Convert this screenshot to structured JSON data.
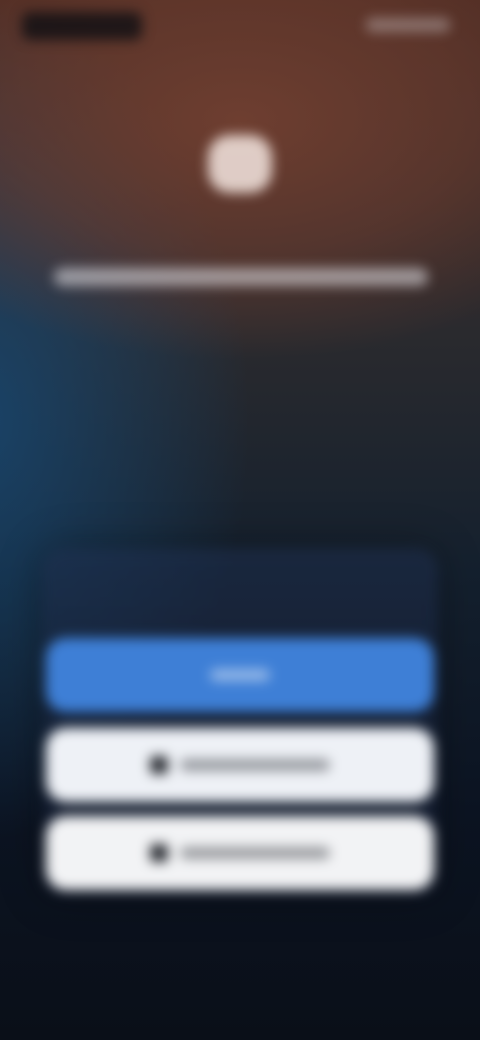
{
  "status_bar": {
    "left_text": "",
    "right_text": ""
  },
  "header": {
    "logo_icon": "app-logo",
    "tagline": ""
  },
  "middle": {
    "subtle_text": ""
  },
  "login_card": {
    "label": "",
    "primary_button": {
      "label": "",
      "icon": ""
    },
    "apple_button": {
      "label": "",
      "icon": "apple-icon"
    },
    "google_button": {
      "label": "",
      "icon": "google-icon"
    }
  },
  "footer": {
    "link_text": ""
  },
  "colors": {
    "primary": "#3e7fd6",
    "button_light": "#eef1f6",
    "background_top": "#4a2a22",
    "background_bottom": "#0a0f18"
  }
}
